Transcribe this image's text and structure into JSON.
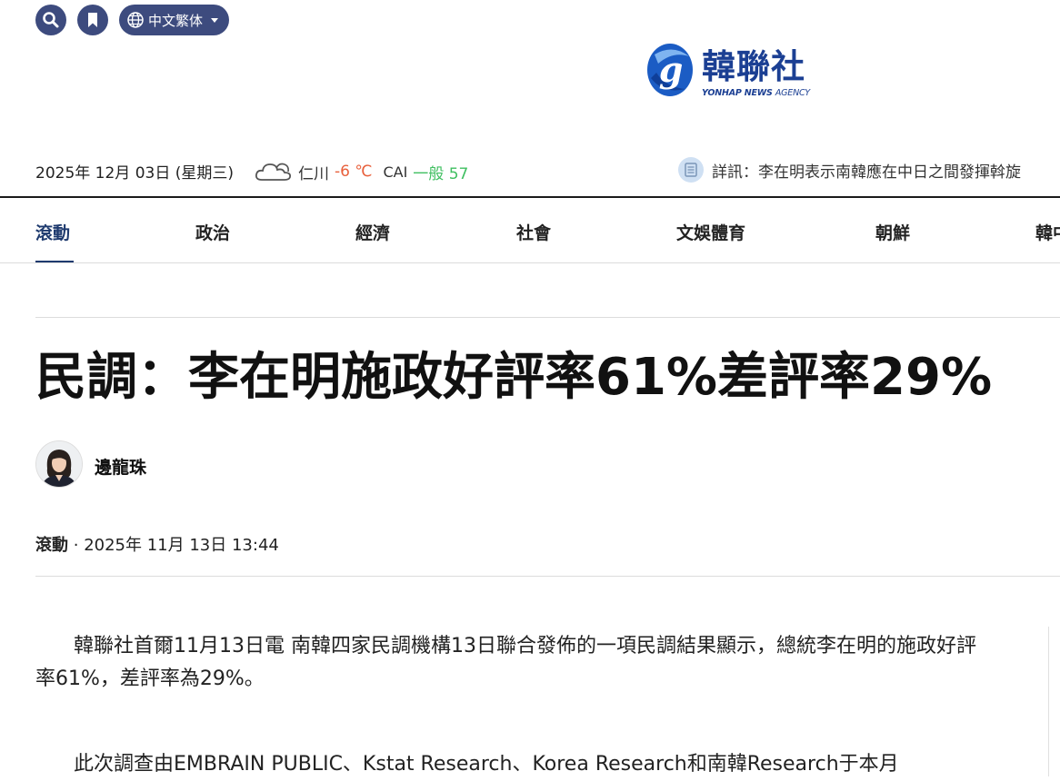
{
  "header": {
    "language_label": "中文繁体",
    "logo": {
      "text": "韓聯社",
      "sub_bold": "YONHAP NEWS",
      "sub_light": "AGENCY"
    }
  },
  "infobar": {
    "date": "2025年 12月 03日 (星期三)",
    "weather_city": "仁川",
    "temperature": "-6 ℃",
    "aqi_label": "CAI",
    "aqi_value": "一般 57",
    "ticker_prefix": "詳訊：",
    "ticker_text": "李在明表示南韓應在中日之間發揮斡旋"
  },
  "nav": {
    "items": [
      "滾動",
      "政治",
      "經濟",
      "社會",
      "文娛體育",
      "朝鮮",
      "韓中"
    ]
  },
  "article": {
    "headline": "民調：李在明施政好評率61%差評率29%",
    "author": "邊龍珠",
    "category": "滾動",
    "separator": "·",
    "timestamp": "2025年 11月 13日 13:44",
    "paragraphs": [
      "韓聯社首爾11月13日電 南韓四家民調機構13日聯合發佈的一項民調結果顯示，總統李在明的施政好評率61%，差評率為29%。",
      "此次調查由EMBRAIN PUBLIC、Kstat Research、Korea Research和南韓Research于本月"
    ]
  },
  "colors": {
    "accent_navy": "#1e3a6e",
    "button_bg": "#3d4b7e",
    "logo_blue": "#1b3f93",
    "temp_orange": "#e8603c",
    "aqi_green": "#3fbf60"
  },
  "icons": {
    "search": "search-icon",
    "bookmark": "bookmark-icon",
    "globe": "globe-icon",
    "weather": "cloud-icon",
    "ticker": "news-list-icon"
  }
}
